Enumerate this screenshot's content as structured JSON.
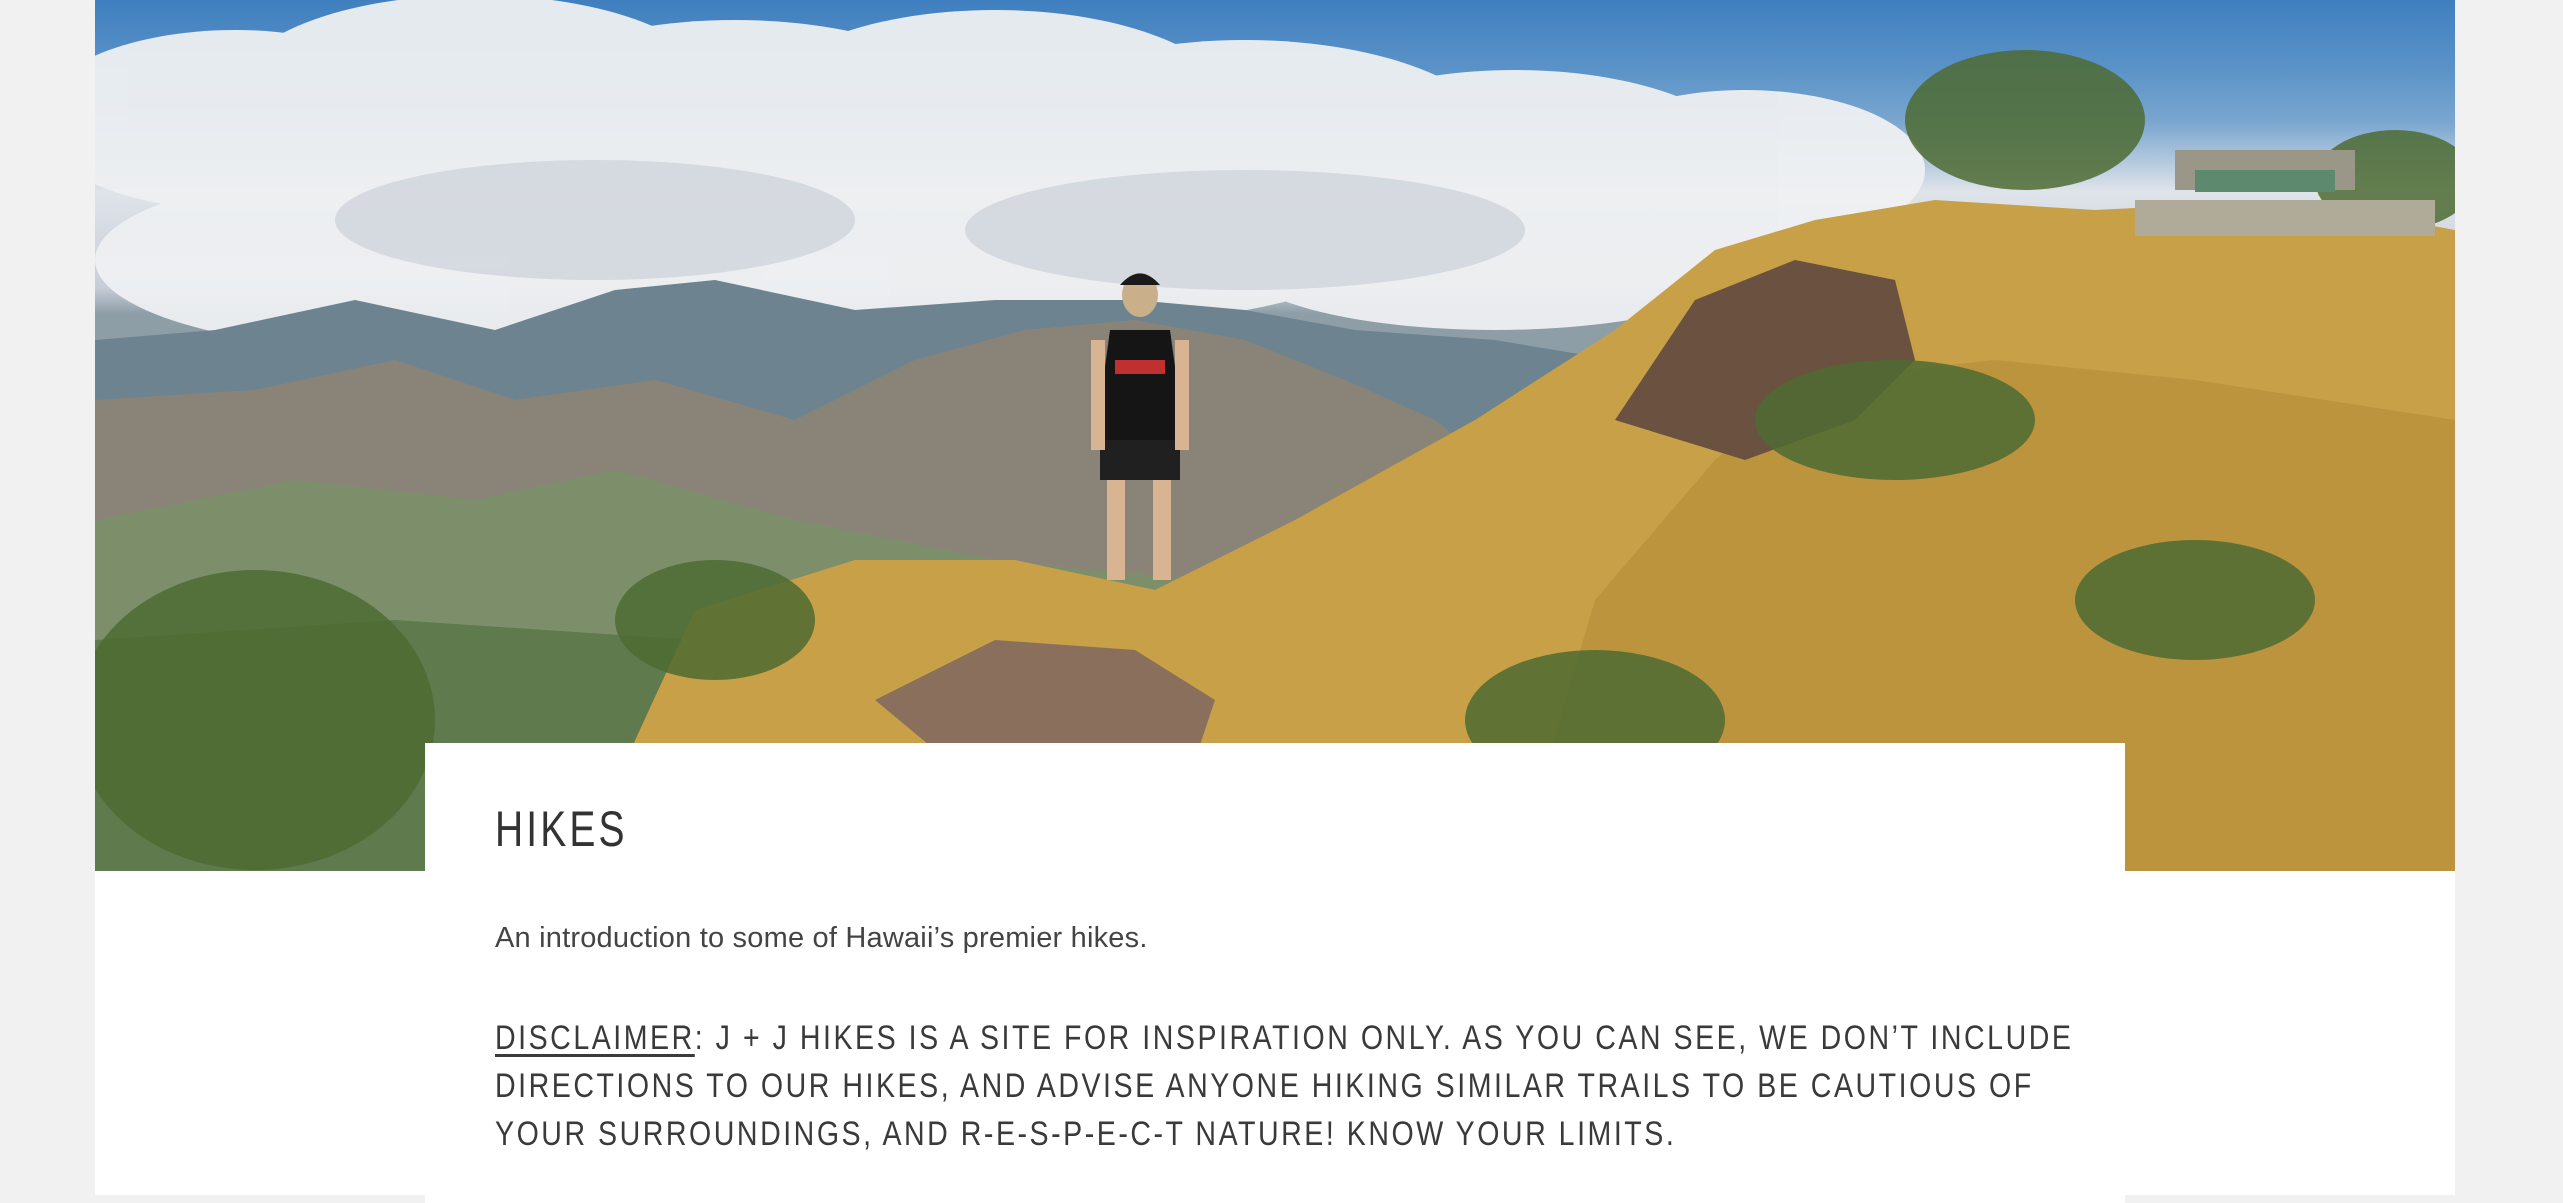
{
  "page": {
    "title": "HIKES",
    "intro": "An introduction to some of Hawaii’s premier hikes.",
    "disclaimer_label": "DISCLAIMER",
    "disclaimer_text": ": J + J HIKES IS A SITE FOR INSPIRATION ONLY. AS YOU CAN SEE, WE DON’T INCLUDE DIRECTIONS TO OUR HIKES, AND ADVISE ANYONE HIKING SIMILAR TRAILS TO BE CAUTIOUS OF YOUR SURROUNDINGS, AND R-E-S-P-E-C-T NATURE! KNOW YOUR LIMITS."
  },
  "hero": {
    "image": "hiker-on-mountain-ridge-photo"
  },
  "colors": {
    "page_bg": "#f1f1f1",
    "content_bg": "#ffffff",
    "text": "#333333",
    "sky": "#4a86c4",
    "grass": "#c79a3a"
  }
}
